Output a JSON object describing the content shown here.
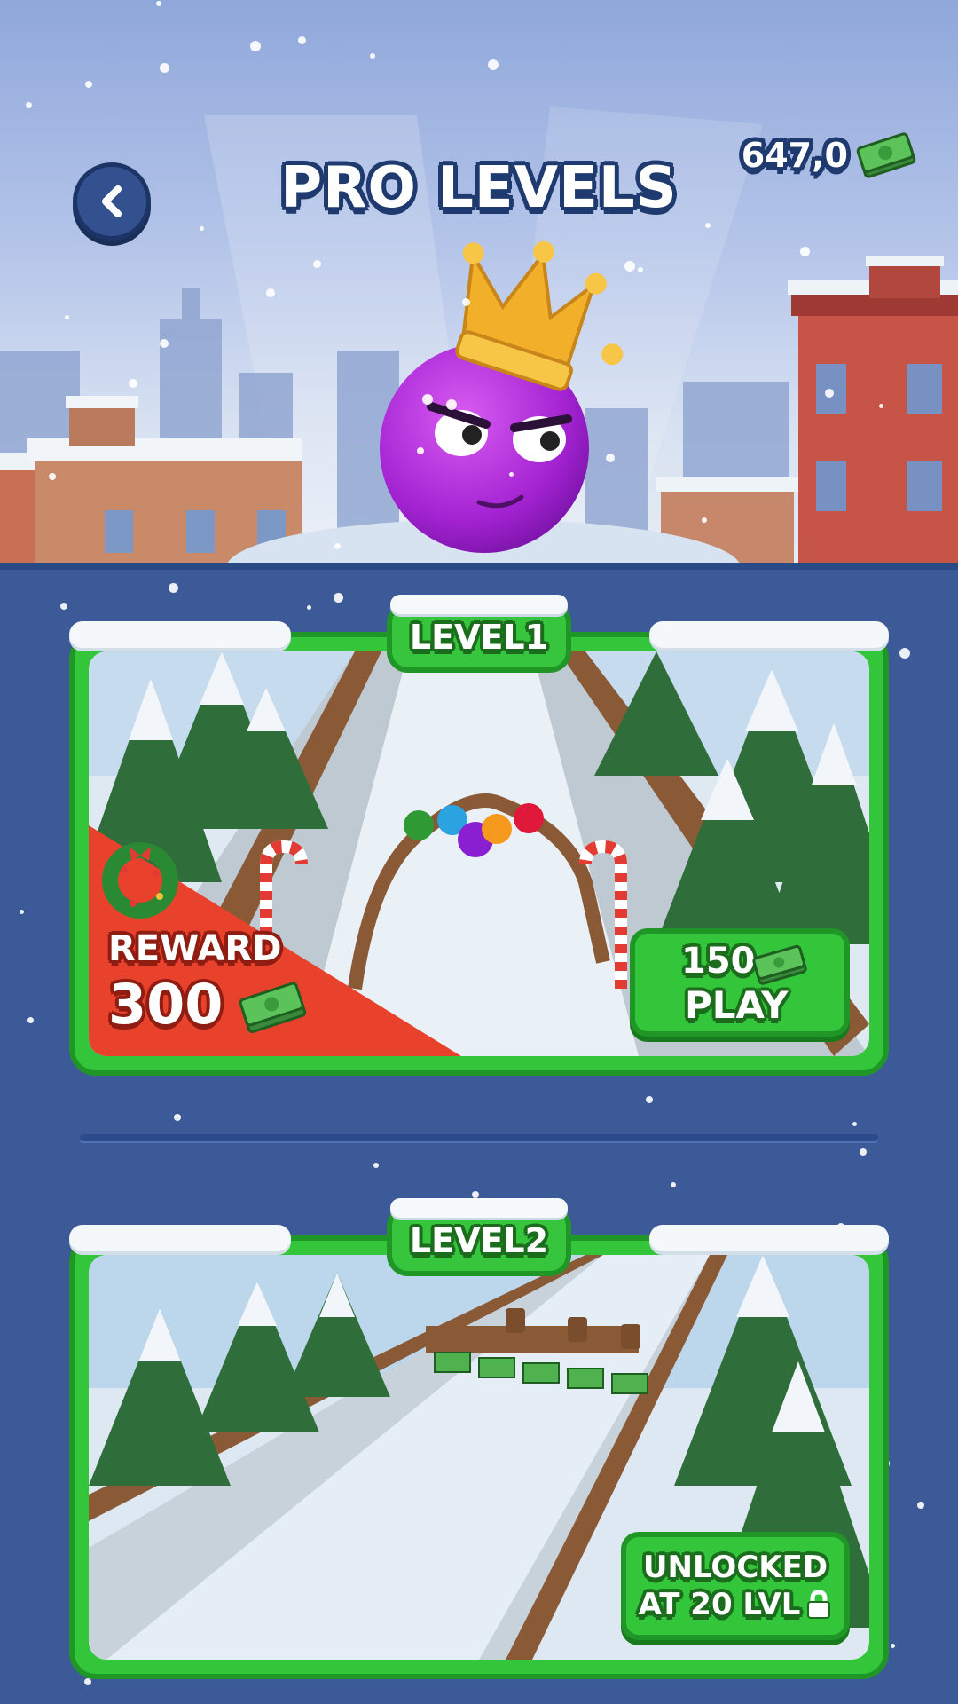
{
  "header": {
    "title": "PRO LEVELS",
    "balance": "647,0",
    "back_icon": "chevron-left-icon",
    "cash_icon": "cash-icon"
  },
  "levels": [
    {
      "tag": "LEVEL1",
      "reward_label": "REWARD",
      "reward_amount": "300",
      "play_cost": "150",
      "play_label": "PLAY",
      "badge_icon": "christmas-wreath-icon"
    },
    {
      "tag": "LEVEL2",
      "unlock_line1": "UNLOCKED",
      "unlock_line2": "AT 20 LVL",
      "lock_icon": "lock-icon"
    }
  ],
  "colors": {
    "panel_blue": "#3c5a98",
    "card_green": "#33c63a",
    "card_border": "#1f9626",
    "reward_red": "#e8422c",
    "ball_purple": "#a726d6",
    "crown_gold": "#f2b02a"
  }
}
